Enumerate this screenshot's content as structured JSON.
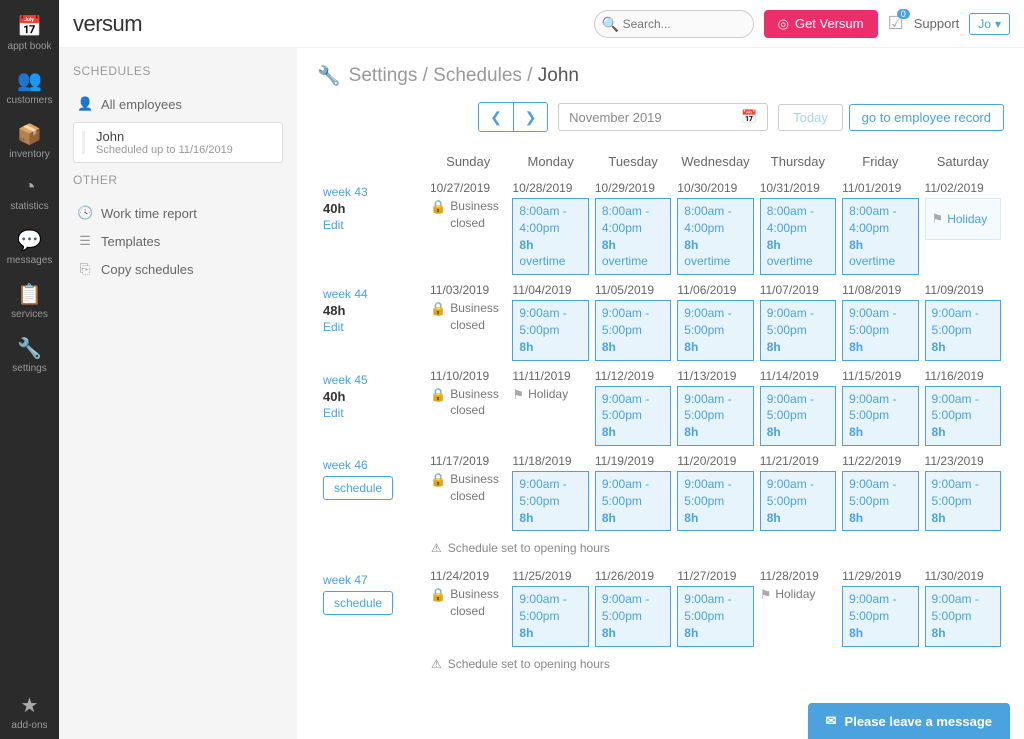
{
  "nav": [
    {
      "icon": "📅",
      "label": "appt book"
    },
    {
      "icon": "👥",
      "label": "customers"
    },
    {
      "icon": "📦",
      "label": "inventory"
    },
    {
      "icon": "◔",
      "label": "statistics"
    },
    {
      "icon": "💬",
      "label": "messages"
    },
    {
      "icon": "📋",
      "label": "services"
    },
    {
      "icon": "🔧",
      "label": "settings"
    }
  ],
  "nav_bottom": {
    "icon": "★",
    "label": "add-ons"
  },
  "logo": "versum",
  "search_placeholder": "Search...",
  "get_btn": "Get Versum",
  "notif_count": "0",
  "support": "Support",
  "user": "Jo",
  "side": {
    "head1": "SCHEDULES",
    "all": "All employees",
    "emp_name": "John",
    "emp_sub": "Scheduled up to 11/16/2019",
    "head2": "OTHER",
    "links": [
      "Work time report",
      "Templates",
      "Copy schedules"
    ],
    "link_icons": [
      "🕓",
      "☰",
      "⎘"
    ]
  },
  "crumb": {
    "a": "Settings",
    "b": "Schedules",
    "c": "John"
  },
  "month": "November 2019",
  "today": "Today",
  "goto": "go to employee record",
  "days": [
    "Sunday",
    "Monday",
    "Tuesday",
    "Wednesday",
    "Thursday",
    "Friday",
    "Saturday"
  ],
  "business_closed": "Business closed",
  "holiday": "Holiday",
  "edit": "Edit",
  "schedule_btn": "schedule",
  "note": "Schedule set to opening hours",
  "weeks": [
    {
      "label": "week 43",
      "hours": "40h",
      "action": "edit",
      "days": [
        {
          "date": "10/27/2019",
          "type": "closed"
        },
        {
          "date": "10/28/2019",
          "type": "ot",
          "l1": "8:00am - 4:00pm",
          "l2": "8h overtime"
        },
        {
          "date": "10/29/2019",
          "type": "ot",
          "l1": "8:00am - 4:00pm",
          "l2": "8h overtime"
        },
        {
          "date": "10/30/2019",
          "type": "ot",
          "l1": "8:00am - 4:00pm",
          "l2": "8h overtime"
        },
        {
          "date": "10/31/2019",
          "type": "ot",
          "l1": "8:00am - 4:00pm",
          "l2": "8h overtime"
        },
        {
          "date": "11/01/2019",
          "type": "ot",
          "l1": "8:00am - 4:00pm",
          "l2": "8h overtime"
        },
        {
          "date": "11/02/2019",
          "type": "hol"
        }
      ]
    },
    {
      "label": "week 44",
      "hours": "48h",
      "action": "edit",
      "days": [
        {
          "date": "11/03/2019",
          "type": "closed"
        },
        {
          "date": "11/04/2019",
          "type": "reg",
          "l1": "9:00am - 5:00pm",
          "l2": "8h"
        },
        {
          "date": "11/05/2019",
          "type": "reg",
          "l1": "9:00am - 5:00pm",
          "l2": "8h"
        },
        {
          "date": "11/06/2019",
          "type": "reg",
          "l1": "9:00am - 5:00pm",
          "l2": "8h"
        },
        {
          "date": "11/07/2019",
          "type": "reg",
          "l1": "9:00am - 5:00pm",
          "l2": "8h"
        },
        {
          "date": "11/08/2019",
          "type": "reg",
          "l1": "9:00am - 5:00pm",
          "l2": "8h"
        },
        {
          "date": "11/09/2019",
          "type": "reg",
          "l1": "9:00am - 5:00pm",
          "l2": "8h"
        }
      ]
    },
    {
      "label": "week 45",
      "hours": "40h",
      "action": "edit",
      "days": [
        {
          "date": "11/10/2019",
          "type": "closed"
        },
        {
          "date": "11/11/2019",
          "type": "holflag"
        },
        {
          "date": "11/12/2019",
          "type": "reg",
          "l1": "9:00am - 5:00pm",
          "l2": "8h"
        },
        {
          "date": "11/13/2019",
          "type": "reg",
          "l1": "9:00am - 5:00pm",
          "l2": "8h"
        },
        {
          "date": "11/14/2019",
          "type": "reg",
          "l1": "9:00am - 5:00pm",
          "l2": "8h"
        },
        {
          "date": "11/15/2019",
          "type": "reg",
          "l1": "9:00am - 5:00pm",
          "l2": "8h"
        },
        {
          "date": "11/16/2019",
          "type": "reg",
          "l1": "9:00am - 5:00pm",
          "l2": "8h"
        }
      ]
    },
    {
      "label": "week 46",
      "action": "schedule",
      "note": true,
      "days": [
        {
          "date": "11/17/2019",
          "type": "closed"
        },
        {
          "date": "11/18/2019",
          "type": "reg",
          "l1": "9:00am - 5:00pm",
          "l2": "8h"
        },
        {
          "date": "11/19/2019",
          "type": "reg",
          "l1": "9:00am - 5:00pm",
          "l2": "8h"
        },
        {
          "date": "11/20/2019",
          "type": "reg",
          "l1": "9:00am - 5:00pm",
          "l2": "8h"
        },
        {
          "date": "11/21/2019",
          "type": "reg",
          "l1": "9:00am - 5:00pm",
          "l2": "8h"
        },
        {
          "date": "11/22/2019",
          "type": "reg",
          "l1": "9:00am - 5:00pm",
          "l2": "8h"
        },
        {
          "date": "11/23/2019",
          "type": "reg",
          "l1": "9:00am - 5:00pm",
          "l2": "8h"
        }
      ]
    },
    {
      "label": "week 47",
      "action": "schedule",
      "note": true,
      "days": [
        {
          "date": "11/24/2019",
          "type": "closed"
        },
        {
          "date": "11/25/2019",
          "type": "reg",
          "l1": "9:00am - 5:00pm",
          "l2": "8h"
        },
        {
          "date": "11/26/2019",
          "type": "reg",
          "l1": "9:00am - 5:00pm",
          "l2": "8h"
        },
        {
          "date": "11/27/2019",
          "type": "reg",
          "l1": "9:00am - 5:00pm",
          "l2": "8h"
        },
        {
          "date": "11/28/2019",
          "type": "holflag"
        },
        {
          "date": "11/29/2019",
          "type": "reg",
          "l1": "9:00am - 5:00pm",
          "l2": "8h"
        },
        {
          "date": "11/30/2019",
          "type": "reg",
          "l1": "9:00am - 5:00pm",
          "l2": "8h"
        }
      ]
    }
  ],
  "chat": "Please leave a message"
}
